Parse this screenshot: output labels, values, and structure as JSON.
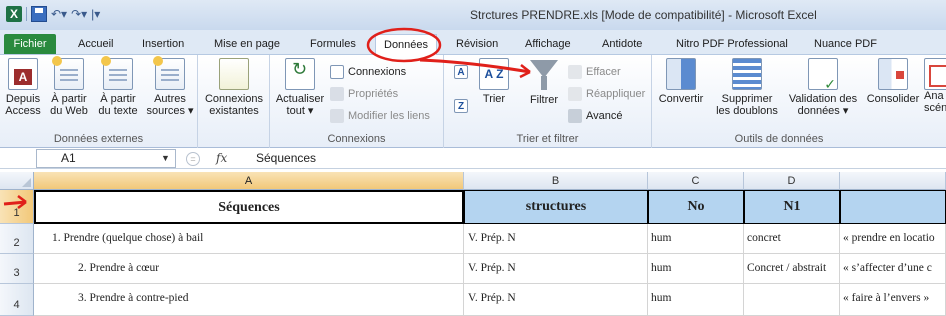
{
  "window": {
    "title": "Strctures PRENDRE.xls  [Mode de compatibilité]  -  Microsoft Excel",
    "app_icon": "X"
  },
  "quick_access": {
    "undo_icon": "undo-arrow",
    "redo_icon": "redo-arrow",
    "customize_glyph": "|▾"
  },
  "tabs": [
    {
      "label": "Fichier"
    },
    {
      "label": "Accueil"
    },
    {
      "label": "Insertion"
    },
    {
      "label": "Mise en page"
    },
    {
      "label": "Formules"
    },
    {
      "label": "Données",
      "active": true
    },
    {
      "label": "Révision"
    },
    {
      "label": "Affichage"
    },
    {
      "label": "Antidote"
    },
    {
      "label": "Nitro PDF Professional"
    },
    {
      "label": "Nuance PDF"
    }
  ],
  "ribbon": {
    "external_data": {
      "label": "Données externes",
      "buttons": [
        {
          "l1": "Depuis",
          "l2": "Access"
        },
        {
          "l1": "À partir",
          "l2": "du Web"
        },
        {
          "l1": "À partir",
          "l2": "du texte"
        },
        {
          "l1": "Autres",
          "l2": "sources ▾"
        }
      ]
    },
    "existing": {
      "l1": "Connexions",
      "l2": "existantes"
    },
    "connections": {
      "label": "Connexions",
      "refresh": {
        "l1": "Actualiser",
        "l2": "tout ▾"
      },
      "items": [
        "Connexions",
        "Propriétés",
        "Modifier les liens"
      ]
    },
    "sort_filter": {
      "label": "Trier et filtrer",
      "sort": "Trier",
      "filter": "Filtrer",
      "items": [
        "Effacer",
        "Réappliquer",
        "Avancé"
      ]
    },
    "data_tools": {
      "label": "Outils de données",
      "buttons": [
        {
          "l1": "Convertir",
          "l2": ""
        },
        {
          "l1": "Supprimer",
          "l2": "les doublons"
        },
        {
          "l1": "Validation des",
          "l2": "données ▾"
        },
        {
          "l1": "Consolider",
          "l2": ""
        },
        {
          "l1": "Ana",
          "l2": "scén"
        }
      ]
    }
  },
  "formula_bar": {
    "name_box": "A1",
    "fx": "fx",
    "value": "Séquences"
  },
  "sheet": {
    "columns": [
      "A",
      "B",
      "C",
      "D",
      ""
    ],
    "rows": [
      {
        "num": "1",
        "cells": [
          "Séquences",
          "structures",
          "No",
          "N1",
          ""
        ]
      },
      {
        "num": "2",
        "cells": [
          "1.  Prendre (quelque chose) à bail",
          "V. Prép. N",
          "hum",
          "concret",
          "« prendre en locatio"
        ]
      },
      {
        "num": "3",
        "cells": [
          "2.     Prendre à cœur",
          "V. Prép. N",
          "hum",
          "Concret / abstrait",
          "« s’affecter d’une c"
        ]
      },
      {
        "num": "4",
        "cells": [
          "3.     Prendre à contre-pied",
          "V. Prép. N",
          "hum",
          "",
          "« faire à l’envers »"
        ]
      }
    ]
  },
  "colors": {
    "tab_fichier": "#2a8a3e",
    "header_blue": "#b4d4f0",
    "annotation_red": "#e0201a"
  }
}
